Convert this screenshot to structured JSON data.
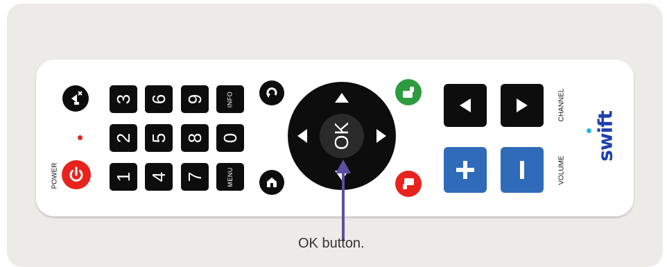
{
  "caption": "OK button.",
  "brand": {
    "logo": "swift",
    "color": "#1e40af",
    "dot_color": "#2ab7e6"
  },
  "colors": {
    "panel": "#ecebe8",
    "remote": "#ffffff",
    "key": "#0d0d0d",
    "power": "#e8231e",
    "volume": "#2f6bb9",
    "arrow": "#5b4fa1",
    "green_button": "#2e9b3e",
    "red_button": "#e8231e"
  },
  "remote": {
    "power_label": "POWER",
    "number_keys": [
      "3",
      "6",
      "9",
      "INFO",
      "2",
      "5",
      "8",
      "0",
      "1",
      "4",
      "7",
      "MENU"
    ],
    "dpad": {
      "center_label": "OK"
    },
    "channel_label": "CHANNEL",
    "volume_label": "VOLUME"
  },
  "icons": [
    "mute-icon",
    "power-icon",
    "back-icon",
    "home-icon",
    "thumbs-up-icon",
    "thumbs-down-icon",
    "triangle-up-icon",
    "triangle-down-icon",
    "triangle-left-icon",
    "triangle-right-icon",
    "plus-icon",
    "minus-icon",
    "play-left-icon",
    "play-right-icon"
  ]
}
